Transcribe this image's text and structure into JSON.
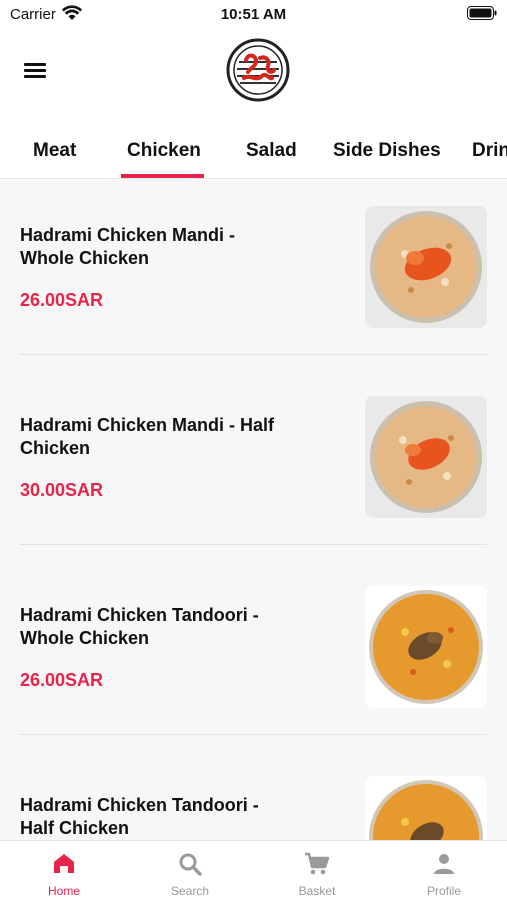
{
  "status_bar": {
    "carrier": "Carrier",
    "time": "10:51 AM"
  },
  "header": {
    "menu_icon": "hamburger-menu-icon",
    "logo_icon": "restaurant-logo-icon"
  },
  "tabs": [
    {
      "label": "Meat"
    },
    {
      "label": "Chicken",
      "selected": true
    },
    {
      "label": "Salad"
    },
    {
      "label": "Side Dishes"
    },
    {
      "label": "Drin"
    }
  ],
  "menu_items": [
    {
      "name": "Hadrami Chicken Mandi - Whole Chicken",
      "price": "26.00SAR"
    },
    {
      "name": "Hadrami Chicken Mandi - Half Chicken",
      "price": "30.00SAR"
    },
    {
      "name": "Hadrami Chicken Tandoori - Whole Chicken",
      "price": "26.00SAR"
    },
    {
      "name": "Hadrami Chicken Tandoori - Half Chicken",
      "price": ""
    }
  ],
  "bottom_nav": [
    {
      "label": "Home",
      "icon": "home-icon",
      "active": true
    },
    {
      "label": "Search",
      "icon": "search-icon"
    },
    {
      "label": "Basket",
      "icon": "cart-icon"
    },
    {
      "label": "Profile",
      "icon": "profile-icon"
    }
  ],
  "colors": {
    "accent": "#e8244a",
    "inactive": "#999999",
    "background": "#f7f7f7"
  }
}
